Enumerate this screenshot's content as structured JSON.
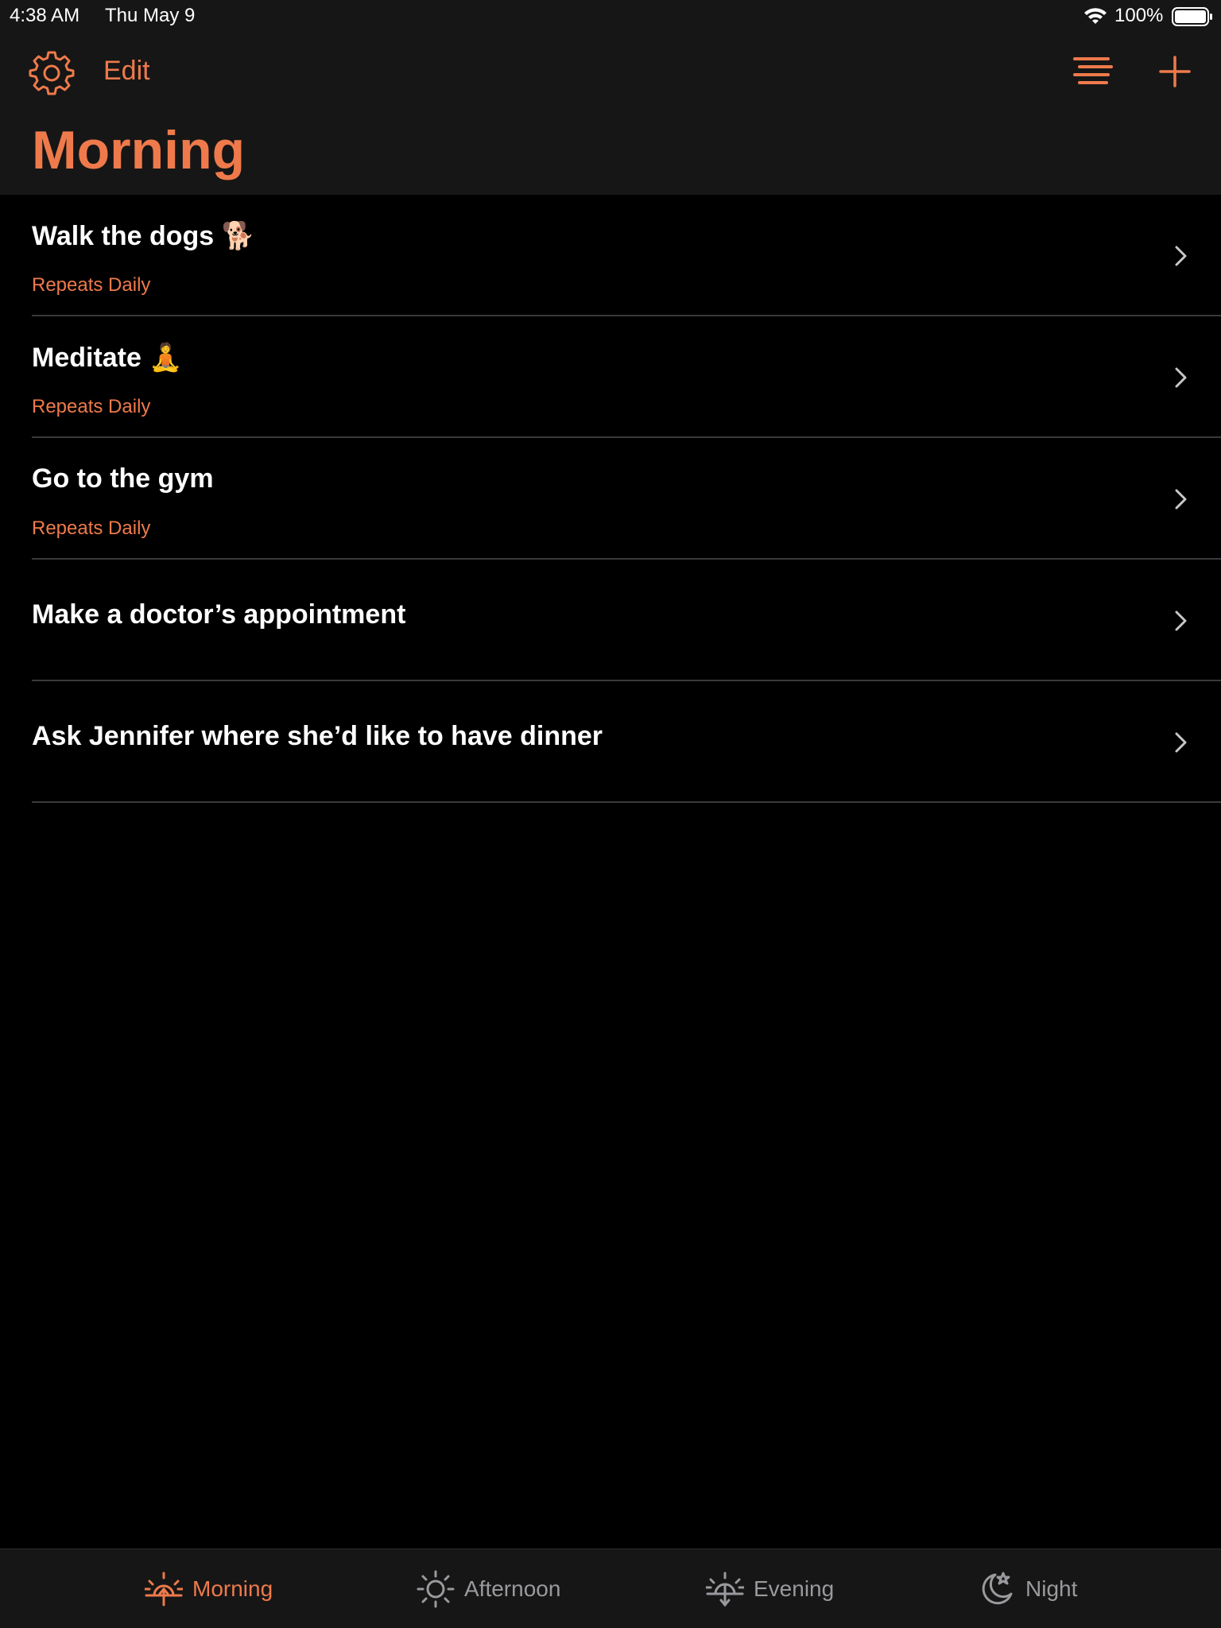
{
  "status_bar": {
    "time": "4:38 AM",
    "date": "Thu May 9",
    "battery": "100%"
  },
  "header": {
    "edit_label": "Edit",
    "title": "Morning"
  },
  "tasks": [
    {
      "title": "Walk the dogs 🐕",
      "subtitle": "Repeats Daily"
    },
    {
      "title": "Meditate 🧘",
      "subtitle": "Repeats Daily"
    },
    {
      "title": "Go to the gym",
      "subtitle": "Repeats Daily"
    },
    {
      "title": "Make a doctor’s appointment",
      "subtitle": ""
    },
    {
      "title": "Ask Jennifer where she’d like to have dinner",
      "subtitle": ""
    }
  ],
  "tabs": [
    {
      "label": "Morning",
      "icon": "sunrise-icon",
      "active": true
    },
    {
      "label": "Afternoon",
      "icon": "sun-icon",
      "active": false
    },
    {
      "label": "Evening",
      "icon": "sunset-icon",
      "active": false
    },
    {
      "label": "Night",
      "icon": "moon-stars-icon",
      "active": false
    }
  ],
  "colors": {
    "accent": "#ee7a4b",
    "background": "#000000",
    "bar_background": "#161616",
    "inactive": "#9a9a9e"
  }
}
